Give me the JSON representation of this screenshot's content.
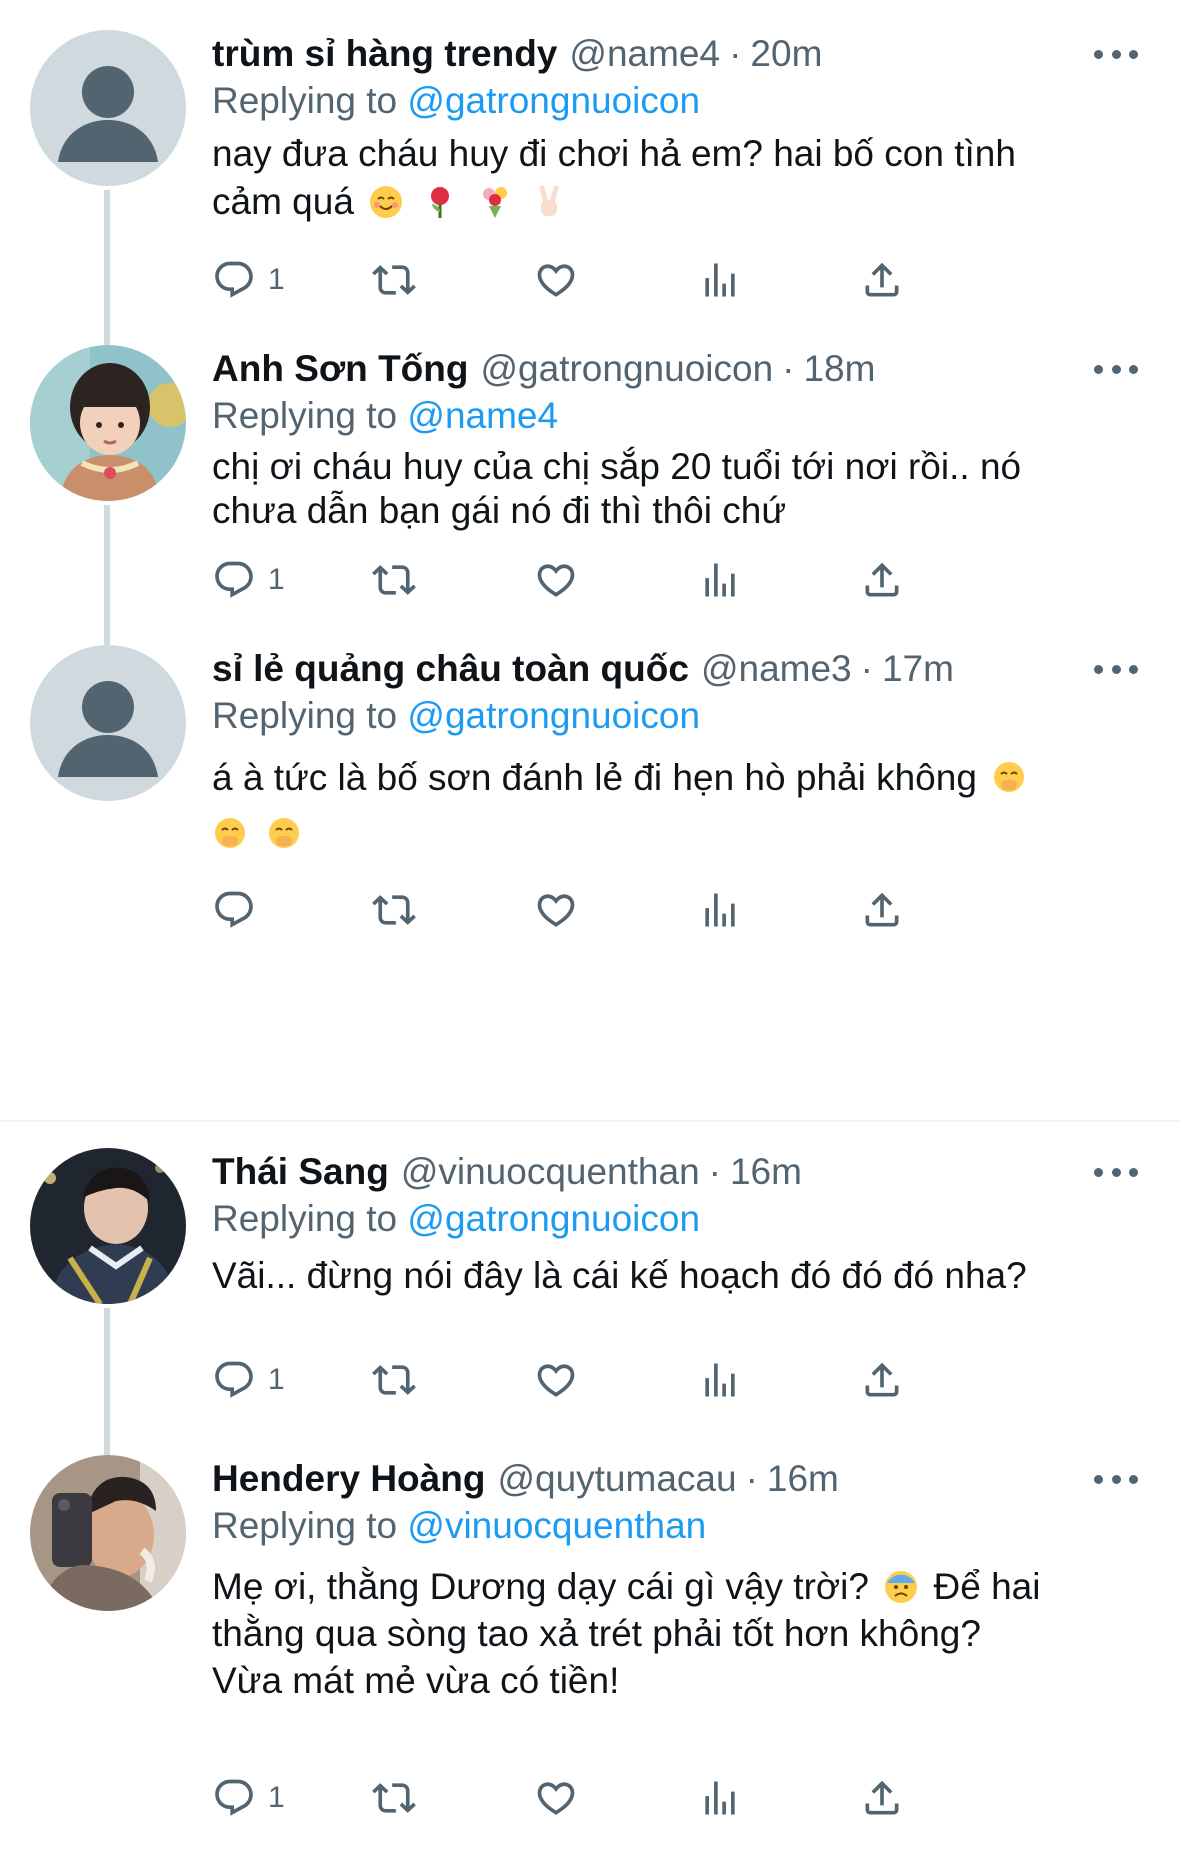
{
  "tweets": [
    {
      "name": "trùm sỉ hàng trendy",
      "handle": "@name4",
      "dot": "·",
      "time": "20m",
      "replying_prefix": "Replying to ",
      "replying_to": "@gatrongnuoicon",
      "lines": [
        "nay đưa cháu huy đi chơi hả em? hai bố con tình",
        "cảm quá"
      ],
      "emojis": [
        "smiling-face-with-hearts",
        "rose",
        "bouquet",
        "victory-hand"
      ],
      "reply_count": "1",
      "avatar": "default-avatar"
    },
    {
      "name": "Anh Sơn Tống",
      "handle": "@gatrongnuoicon",
      "dot": "·",
      "time": "18m",
      "replying_prefix": "Replying to ",
      "replying_to": "@name4",
      "lines": [
        "chị ơi cháu huy của chị sắp 20 tuổi tới nơi rồi.. nó",
        "chưa dẫn bạn gái nó đi thì thôi chứ"
      ],
      "reply_count": "1",
      "avatar": "child-photo"
    },
    {
      "name": "sỉ lẻ quảng châu toàn quốc",
      "handle": "@name3",
      "dot": "·",
      "time": "17m",
      "replying_prefix": "Replying to ",
      "replying_to": "@gatrongnuoicon",
      "lines": [
        "á à tức là bố sơn đánh lẻ đi hẹn hò phải không"
      ],
      "emojis": [
        "face-with-hand-over-mouth",
        "face-with-hand-over-mouth",
        "face-with-hand-over-mouth"
      ],
      "reply_count": "",
      "avatar": "default-avatar"
    },
    {
      "name": "Thái Sang",
      "handle": "@vinuocquenthan",
      "dot": "·",
      "time": "16m",
      "replying_prefix": "Replying to ",
      "replying_to": "@gatrongnuoicon",
      "lines": [
        "Vãi... đừng nói đây là cái kế hoạch đó đó đó nha?"
      ],
      "reply_count": "1",
      "avatar": "young-man-photo"
    },
    {
      "name": "Hendery Hoàng",
      "handle": "@quytumacau",
      "dot": "·",
      "time": "16m",
      "replying_prefix": "Replying to ",
      "replying_to": "@vinuocquenthan",
      "lines": [
        "Mẹ ơi, thằng Dương dạy cái gì vậy trời?",
        "Để hai",
        "thằng qua sòng tao xả trét phải tốt hơn không?",
        "Vừa mát mẻ vừa có tiền!"
      ],
      "emojis": [
        "anxious-face-with-sweat"
      ],
      "reply_count": "1",
      "avatar": "selfie-photo"
    }
  ],
  "icons": [
    "reply-icon",
    "retweet-icon",
    "like-icon",
    "analytics-icon",
    "share-icon",
    "more-icon"
  ],
  "colors": {
    "text": "#0f1419",
    "secondary": "#536471",
    "link": "#1d9bf0",
    "thread_line": "#cfd9de"
  }
}
